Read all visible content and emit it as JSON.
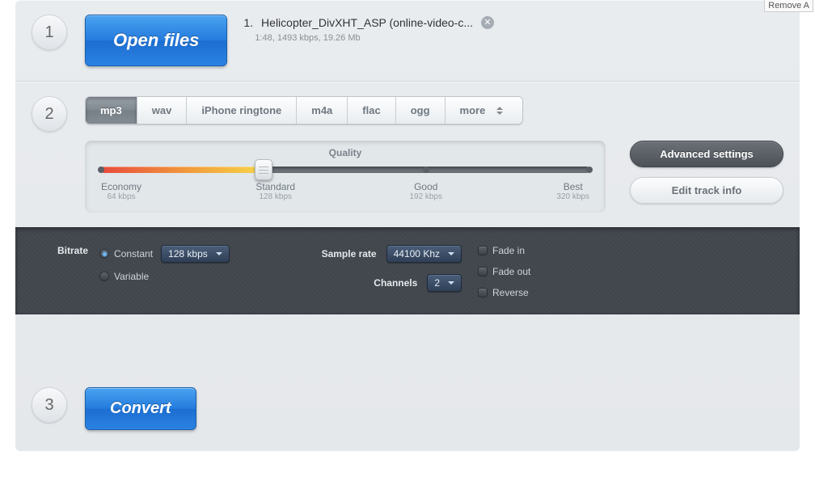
{
  "remove_a": "Remove A",
  "step1": {
    "number": "1",
    "open_files_button": "Open files",
    "file": {
      "index": "1.",
      "name": "Helicopter_DivXHT_ASP (online-video-c...",
      "meta": "1:48, 1493 kbps, 19.26 Mb"
    }
  },
  "step2": {
    "number": "2",
    "tabs": [
      "mp3",
      "wav",
      "iPhone ringtone",
      "m4a",
      "flac",
      "ogg",
      "more"
    ],
    "active_tab": "mp3",
    "quality": {
      "title": "Quality",
      "points": [
        {
          "label": "Economy",
          "sub": "64 kbps"
        },
        {
          "label": "Standard",
          "sub": "128 kbps"
        },
        {
          "label": "Good",
          "sub": "192 kbps"
        },
        {
          "label": "Best",
          "sub": "320 kbps"
        }
      ],
      "selected_index": 1
    },
    "advanced_settings_btn": "Advanced settings",
    "edit_track_info_btn": "Edit track info"
  },
  "advanced": {
    "bitrate_label": "Bitrate",
    "bitrate_mode": {
      "constant": "Constant",
      "variable": "Variable",
      "selected": "constant"
    },
    "bitrate_value": "128 kbps",
    "sample_rate_label": "Sample rate",
    "sample_rate_value": "44100 Khz",
    "channels_label": "Channels",
    "channels_value": "2",
    "fade_in": "Fade in",
    "fade_out": "Fade out",
    "reverse": "Reverse"
  },
  "step3": {
    "number": "3",
    "convert_button": "Convert"
  }
}
